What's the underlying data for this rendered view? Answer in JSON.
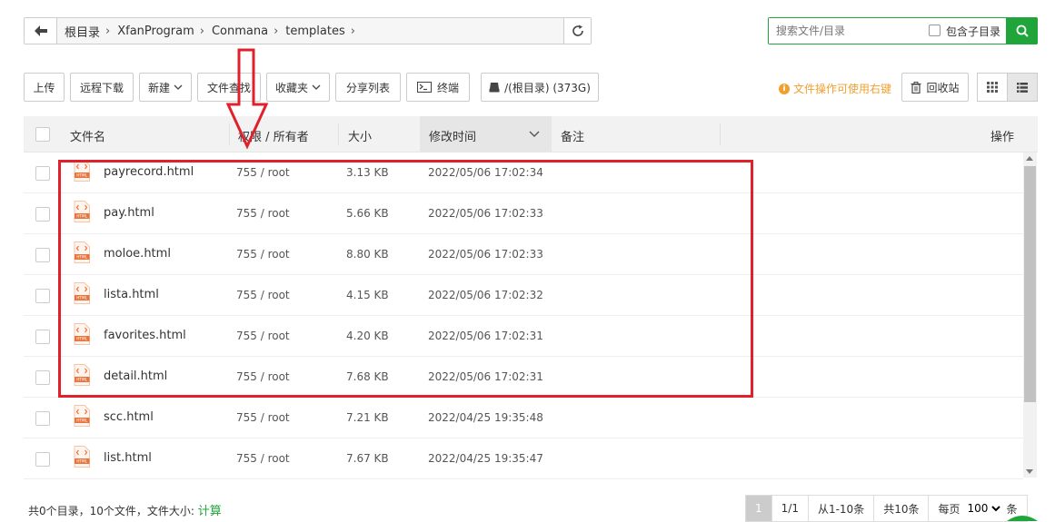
{
  "breadcrumb": {
    "segments": [
      "根目录",
      "XfanProgram",
      "Conmana",
      "templates"
    ],
    "separator": "›"
  },
  "search": {
    "placeholder": "搜索文件/目录",
    "include_subdir_label": "包含子目录"
  },
  "toolbar": {
    "upload": "上传",
    "remote_download": "远程下载",
    "new": "新建",
    "file_search": "文件查找",
    "favorites": "收藏夹",
    "share_list": "分享列表",
    "terminal": "终端",
    "disk": "/(根目录) (373G)",
    "tip": "文件操作可使用右键",
    "recycle": "回收站"
  },
  "table": {
    "headers": {
      "name": "文件名",
      "perm": "权限 / 所有者",
      "size": "大小",
      "mtime": "修改时间",
      "remark": "备注",
      "ops": "操作"
    },
    "rows": [
      {
        "name": "payrecord.html",
        "perm": "755 / root",
        "size": "3.13 KB",
        "mtime": "2022/05/06 17:02:34"
      },
      {
        "name": "pay.html",
        "perm": "755 / root",
        "size": "5.66 KB",
        "mtime": "2022/05/06 17:02:33"
      },
      {
        "name": "moloe.html",
        "perm": "755 / root",
        "size": "8.80 KB",
        "mtime": "2022/05/06 17:02:33"
      },
      {
        "name": "lista.html",
        "perm": "755 / root",
        "size": "4.15 KB",
        "mtime": "2022/05/06 17:02:32"
      },
      {
        "name": "favorites.html",
        "perm": "755 / root",
        "size": "4.20 KB",
        "mtime": "2022/05/06 17:02:31"
      },
      {
        "name": "detail.html",
        "perm": "755 / root",
        "size": "7.68 KB",
        "mtime": "2022/05/06 17:02:31"
      },
      {
        "name": "scc.html",
        "perm": "755 / root",
        "size": "7.21 KB",
        "mtime": "2022/04/25 19:35:48"
      },
      {
        "name": "list.html",
        "perm": "755 / root",
        "size": "7.67 KB",
        "mtime": "2022/04/25 19:35:47"
      }
    ]
  },
  "footer": {
    "summary": "共0个目录，10个文件，文件大小: ",
    "calc": "计算",
    "page_current": "1",
    "page_total": "1/1",
    "range": "从1-10条",
    "total": "共10条",
    "per_page_label": "每页",
    "per_page_value": "100",
    "per_page_suffix": "条"
  },
  "colors": {
    "accent": "#20a53a",
    "tip": "#f0a030",
    "annotation": "#e0202a"
  }
}
